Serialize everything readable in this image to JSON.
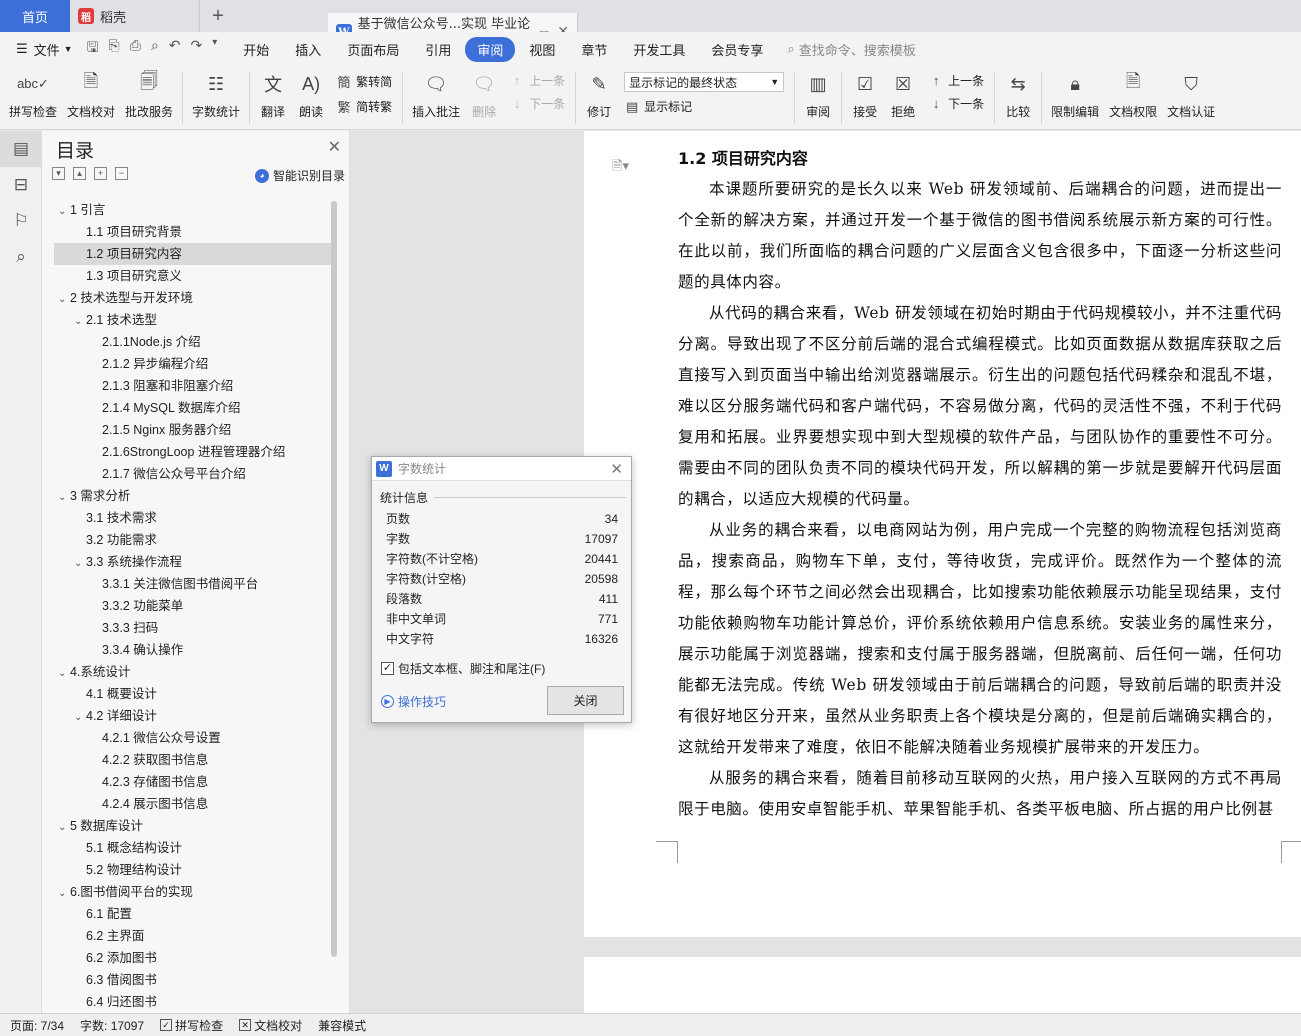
{
  "tabs": {
    "home": "首页",
    "daoke": "稻壳",
    "doc": "基于微信公众号...实现 毕业论文"
  },
  "menubar": {
    "file": "文件",
    "items": [
      "开始",
      "插入",
      "页面布局",
      "引用",
      "审阅",
      "视图",
      "章节",
      "开发工具",
      "会员专享"
    ],
    "active": "审阅",
    "search": "查找命令、搜索模板"
  },
  "ribbon": {
    "spell": "拼写检查",
    "proof": "文档校对",
    "correct": "批改服务",
    "wordcount": "字数统计",
    "translate": "翻译",
    "read": "朗读",
    "trad": "繁转简",
    "simp": "简转繁",
    "insert_comment": "插入批注",
    "delete": "删除",
    "prev": "上一条",
    "next": "下一条",
    "revise": "修订",
    "markup_select": "显示标记的最终状态",
    "show_markup": "显示标记",
    "review": "审阅",
    "accept": "接受",
    "reject": "拒绝",
    "prev2": "上一条",
    "next2": "下一条",
    "compare": "比较",
    "restrict": "限制编辑",
    "rights": "文档权限",
    "cert": "文档认证"
  },
  "toc": {
    "title": "目录",
    "smart": "智能识别目录",
    "items": [
      {
        "label": "1 引言",
        "level": 0,
        "arrow": true
      },
      {
        "label": "1.1 项目研究背景",
        "level": 1
      },
      {
        "label": "1.2 项目研究内容",
        "level": 1,
        "selected": true
      },
      {
        "label": "1.3 项目研究意义",
        "level": 1
      },
      {
        "label": "2 技术选型与开发环境",
        "level": 0,
        "arrow": true
      },
      {
        "label": "2.1 技术选型",
        "level": 1,
        "arrow": true
      },
      {
        "label": "2.1.1Node.js 介绍",
        "level": 2
      },
      {
        "label": "2.1.2 异步编程介绍",
        "level": 2
      },
      {
        "label": "2.1.3 阻塞和非阻塞介绍",
        "level": 2
      },
      {
        "label": "2.1.4 MySQL 数据库介绍",
        "level": 2
      },
      {
        "label": "2.1.5 Nginx 服务器介绍",
        "level": 2
      },
      {
        "label": "2.1.6StrongLoop 进程管理器介绍",
        "level": 2
      },
      {
        "label": "2.1.7 微信公众号平台介绍",
        "level": 2
      },
      {
        "label": "3 需求分析",
        "level": 0,
        "arrow": true
      },
      {
        "label": "3.1 技术需求",
        "level": 1
      },
      {
        "label": "3.2 功能需求",
        "level": 1
      },
      {
        "label": "3.3 系统操作流程",
        "level": 1,
        "arrow": true
      },
      {
        "label": "3.3.1 关注微信图书借阅平台",
        "level": 2
      },
      {
        "label": "3.3.2 功能菜单",
        "level": 2
      },
      {
        "label": "3.3.3 扫码",
        "level": 2
      },
      {
        "label": "3.3.4 确认操作",
        "level": 2
      },
      {
        "label": "4.系统设计",
        "level": 0,
        "arrow": true
      },
      {
        "label": "4.1 概要设计",
        "level": 1
      },
      {
        "label": "4.2 详细设计",
        "level": 1,
        "arrow": true
      },
      {
        "label": "4.2.1 微信公众号设置",
        "level": 2
      },
      {
        "label": "4.2.2 获取图书信息",
        "level": 2
      },
      {
        "label": "4.2.3 存储图书信息",
        "level": 2
      },
      {
        "label": "4.2.4 展示图书信息",
        "level": 2
      },
      {
        "label": "5 数据库设计",
        "level": 0,
        "arrow": true
      },
      {
        "label": "5.1 概念结构设计",
        "level": 1
      },
      {
        "label": "5.2 物理结构设计",
        "level": 1
      },
      {
        "label": "6.图书借阅平台的实现",
        "level": 0,
        "arrow": true
      },
      {
        "label": "6.1 配置",
        "level": 1
      },
      {
        "label": "6.2 主界面",
        "level": 1
      },
      {
        "label": "6.2 添加图书",
        "level": 1
      },
      {
        "label": "6.3 借阅图书",
        "level": 1
      },
      {
        "label": "6.4 归还图书",
        "level": 1
      }
    ]
  },
  "document": {
    "heading": "1.2 项目研究内容",
    "paragraphs": [
      "本课题所要研究的是长久以来 Web 研发领域前、后端耦合的问题，进而提出一个全新的解决方案，并通过开发一个基于微信的图书借阅系统展示新方案的可行性。在此以前，我们所面临的耦合问题的广义层面含义包含很多中，下面逐一分析这些问题的具体内容。",
      "从代码的耦合来看，Web 研发领域在初始时期由于代码规模较小，并不注重代码分离。导致出现了不区分前后端的混合式编程模式。比如页面数据从数据库获取之后直接写入到页面当中输出给浏览器端展示。衍生出的问题包括代码糅杂和混乱不堪，难以区分服务端代码和客户端代码，不容易做分离，代码的灵活性不强，不利于代码复用和拓展。业界要想实现中到大型规模的软件产品，与团队协作的重要性不可分。需要由不同的团队负责不同的模块代码开发，所以解耦的第一步就是要解开代码层面的耦合，以适应大规模的代码量。",
      "从业务的耦合来看，以电商网站为例，用户完成一个完整的购物流程包括浏览商品，搜索商品，购物车下单，支付，等待收货，完成评价。既然作为一个整体的流程，那么每个环节之间必然会出现耦合，比如搜索功能依赖展示功能呈现结果，支付功能依赖购物车功能计算总价，评价系统依赖用户信息系统。安装业务的属性来分，展示功能属于浏览器端，搜索和支付属于服务器端，但脱离前、后任何一端，任何功能都无法完成。传统 Web 研发领域由于前后端耦合的问题，导致前后端的职责并没有很好地区分开来，虽然从业务职责上各个模块是分离的，但是前后端确实耦合的，这就给开发带来了难度，依旧不能解决随着业务规模扩展带来的开发压力。",
      "从服务的耦合来看，随着目前移动互联网的火热，用户接入互联网的方式不再局限于电脑。使用安卓智能手机、苹果智能手机、各类平板电脑、所占据的用户比例甚"
    ]
  },
  "dialog": {
    "title": "字数统计",
    "section": "统计信息",
    "rows": [
      {
        "label": "页数",
        "value": "34"
      },
      {
        "label": "字数",
        "value": "17097"
      },
      {
        "label": "字符数(不计空格)",
        "value": "20441"
      },
      {
        "label": "字符数(计空格)",
        "value": "20598"
      },
      {
        "label": "段落数",
        "value": "411"
      },
      {
        "label": "非中文单词",
        "value": "771"
      },
      {
        "label": "中文字符",
        "value": "16326"
      }
    ],
    "checkbox": "包括文本框、脚注和尾注(F)",
    "tips": "操作技巧",
    "close": "关闭"
  },
  "status": {
    "page": "页面: 7/34",
    "words": "字数: 17097",
    "spell": "拼写检查",
    "proof": "文档校对",
    "compat": "兼容模式"
  },
  "colors": {
    "accent": "#3c6fd8"
  }
}
